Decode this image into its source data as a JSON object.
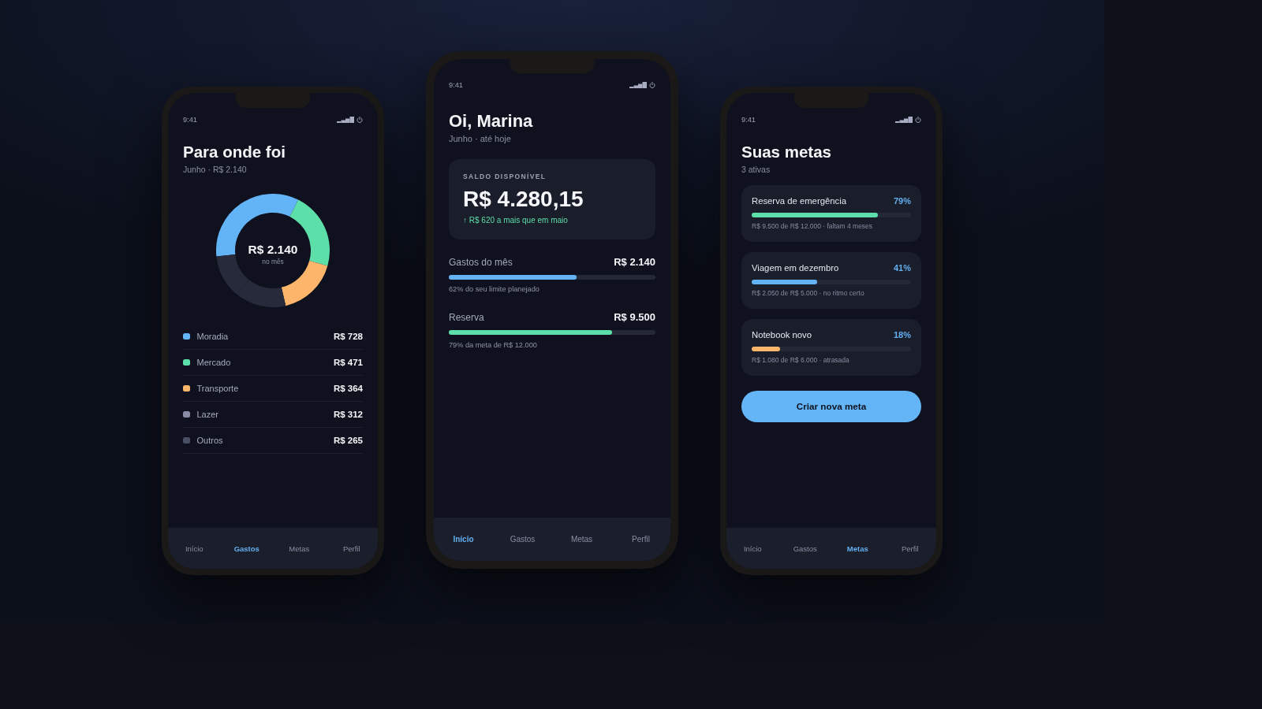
{
  "phones": [
    {
      "kind": "spending",
      "status_time": "9:41",
      "title": "Para onde foi",
      "subtitle": "Junho · R$ 2.140",
      "donut": {
        "center_value": "R$ 2.140",
        "center_label": "no mês",
        "chart_data": {
          "type": "donut",
          "values": [
            34.02,
            22.01,
            17.01,
            14.58,
            12.38
          ],
          "colors": [
            "#63b3f7",
            "#5cdfa9",
            "#fcb56b",
            "#262a3b",
            "#262a3b"
          ]
        }
      },
      "categories": [
        {
          "name": "Moradia",
          "amount": "R$ 728",
          "color": "#63b3f7"
        },
        {
          "name": "Mercado",
          "amount": "R$ 471",
          "color": "#5cdfa9"
        },
        {
          "name": "Transporte",
          "amount": "R$ 364",
          "color": "#fcb56b"
        },
        {
          "name": "Lazer",
          "amount": "R$ 312",
          "color": "#888ca6"
        },
        {
          "name": "Outros",
          "amount": "R$ 265",
          "color": "#4b4f66"
        }
      ],
      "nav": [
        {
          "label": "Início",
          "selected": false
        },
        {
          "label": "Gastos",
          "selected": true
        },
        {
          "label": "Metas",
          "selected": false
        },
        {
          "label": "Perfil",
          "selected": false
        }
      ]
    },
    {
      "kind": "home",
      "status_time": "9:41",
      "title": "Oi, Marina",
      "subtitle": "Junho · até hoje",
      "balance_card": {
        "label": "SALDO DISPONÍVEL",
        "amount": "R$ 4.280,15",
        "change": "↑ R$ 620 a mais que em maio"
      },
      "metrics": [
        {
          "label": "Gastos do mês",
          "value": "R$ 2.140",
          "level": 0.62,
          "color": "#63b3f7",
          "caption": "62% do seu limite planejado"
        },
        {
          "label": "Reserva",
          "value": "R$ 9.500",
          "level": 0.79,
          "color": "#5cdfa9",
          "caption": "79% da meta de R$ 12.000"
        }
      ],
      "nav": [
        {
          "label": "Início",
          "selected": true
        },
        {
          "label": "Gastos",
          "selected": false
        },
        {
          "label": "Metas",
          "selected": false
        },
        {
          "label": "Perfil",
          "selected": false
        }
      ]
    },
    {
      "kind": "goals",
      "status_time": "9:41",
      "title": "Suas metas",
      "subtitle": "3 ativas",
      "goals": [
        {
          "name": "Reserva de emergência",
          "percent": "79%",
          "level": 0.79,
          "color": "#5cdfa9",
          "caption": "R$ 9.500 de R$ 12.000 · faltam 4 meses"
        },
        {
          "name": "Viagem em dezembro",
          "percent": "41%",
          "level": 0.41,
          "color": "#63b3f7",
          "caption": "R$ 2.050 de R$ 5.000 · no ritmo certo"
        },
        {
          "name": "Notebook novo",
          "percent": "18%",
          "level": 0.18,
          "color": "#fcb56b",
          "caption": "R$ 1.080 de R$ 6.000 · atrasada"
        }
      ],
      "button": "Criar nova meta",
      "nav": [
        {
          "label": "Início",
          "selected": false
        },
        {
          "label": "Gastos",
          "selected": false
        },
        {
          "label": "Metas",
          "selected": true
        },
        {
          "label": "Perfil",
          "selected": false
        }
      ]
    }
  ]
}
